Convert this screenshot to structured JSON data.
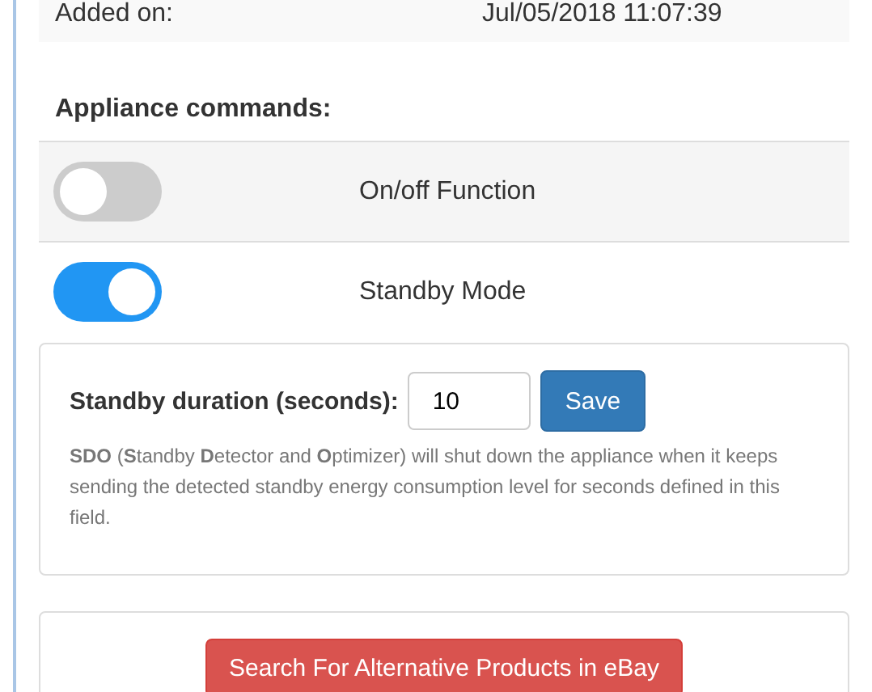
{
  "details": [
    {
      "label": "Added on:",
      "value": "Jul/05/2018 11:07:39"
    }
  ],
  "commands": {
    "heading": "Appliance commands:",
    "items": [
      {
        "label": "On/off Function",
        "on": false
      },
      {
        "label": "Standby Mode",
        "on": true
      }
    ]
  },
  "standby": {
    "label": "Standby duration (seconds):",
    "value": "10",
    "save": "Save",
    "help": "**SDO** (**S**tandby **D**etector and **O**ptimizer) will shut down the appliance when it keeps sending the detected standby energy consumption level for seconds defined in this field."
  },
  "alternative_button": "Search For Alternative Products in eBay"
}
